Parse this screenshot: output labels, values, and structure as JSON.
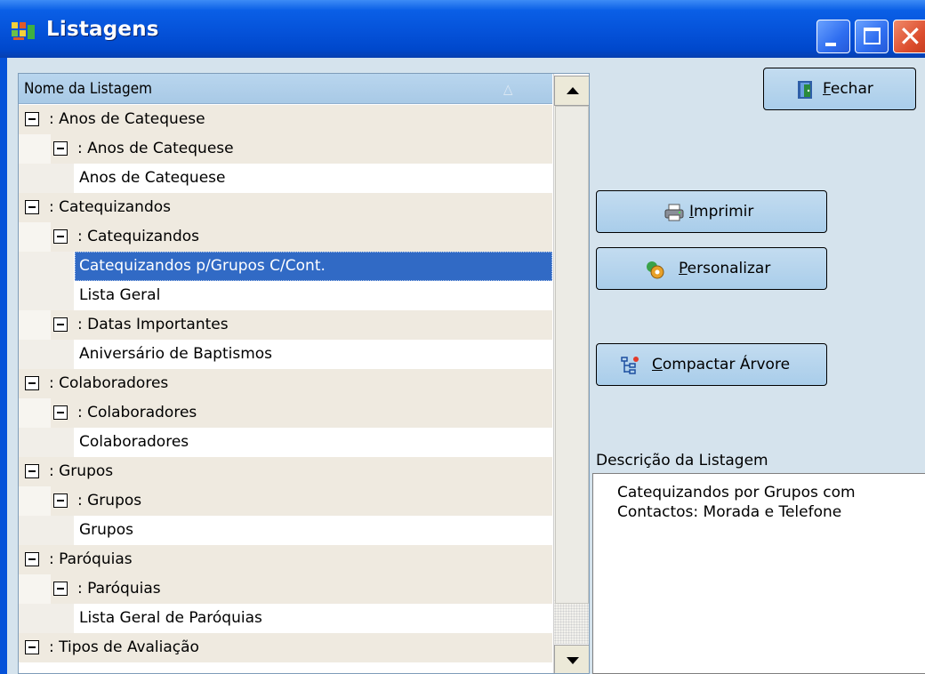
{
  "window": {
    "title": "Listagens"
  },
  "tree": {
    "header": "Nome da Listagem",
    "rows": [
      {
        "level": 1,
        "label": ": Anos de Catequese"
      },
      {
        "level": 2,
        "label": ": Anos de Catequese"
      },
      {
        "level": 3,
        "label": "Anos de Catequese"
      },
      {
        "level": 1,
        "label": ": Catequizandos"
      },
      {
        "level": 2,
        "label": ": Catequizandos"
      },
      {
        "level": 3,
        "label": "Catequizandos p/Grupos C/Cont.",
        "selected": true
      },
      {
        "level": 3,
        "label": "Lista Geral"
      },
      {
        "level": 2,
        "label": ": Datas Importantes"
      },
      {
        "level": 3,
        "label": "Aniversário de Baptismos"
      },
      {
        "level": 1,
        "label": ": Colaboradores"
      },
      {
        "level": 2,
        "label": ": Colaboradores"
      },
      {
        "level": 3,
        "label": "Colaboradores"
      },
      {
        "level": 1,
        "label": ": Grupos"
      },
      {
        "level": 2,
        "label": ": Grupos"
      },
      {
        "level": 3,
        "label": "Grupos"
      },
      {
        "level": 1,
        "label": ": Paróquias"
      },
      {
        "level": 2,
        "label": ": Paróquias"
      },
      {
        "level": 3,
        "label": "Lista Geral de Paróquias"
      },
      {
        "level": 1,
        "label": ": Tipos de Avaliação"
      }
    ]
  },
  "buttons": {
    "fechar": {
      "hotkey": "F",
      "rest": "echar"
    },
    "imprimir": {
      "hotkey": "I",
      "rest": "mprimir"
    },
    "personalizar": {
      "hotkey": "P",
      "rest": "ersonalizar"
    },
    "compactar": {
      "hotkey": "C",
      "rest": "ompactar Árvore"
    }
  },
  "description": {
    "label": "Descrição da Listagem",
    "text": "Catequizandos por Grupos com\nContactos: Morada e Telefone"
  },
  "colors": {
    "titlebar": "#0552d9",
    "window_bg": "#d5e3ed",
    "selection": "#316ac5",
    "button_bg": "#b6d5ed"
  }
}
